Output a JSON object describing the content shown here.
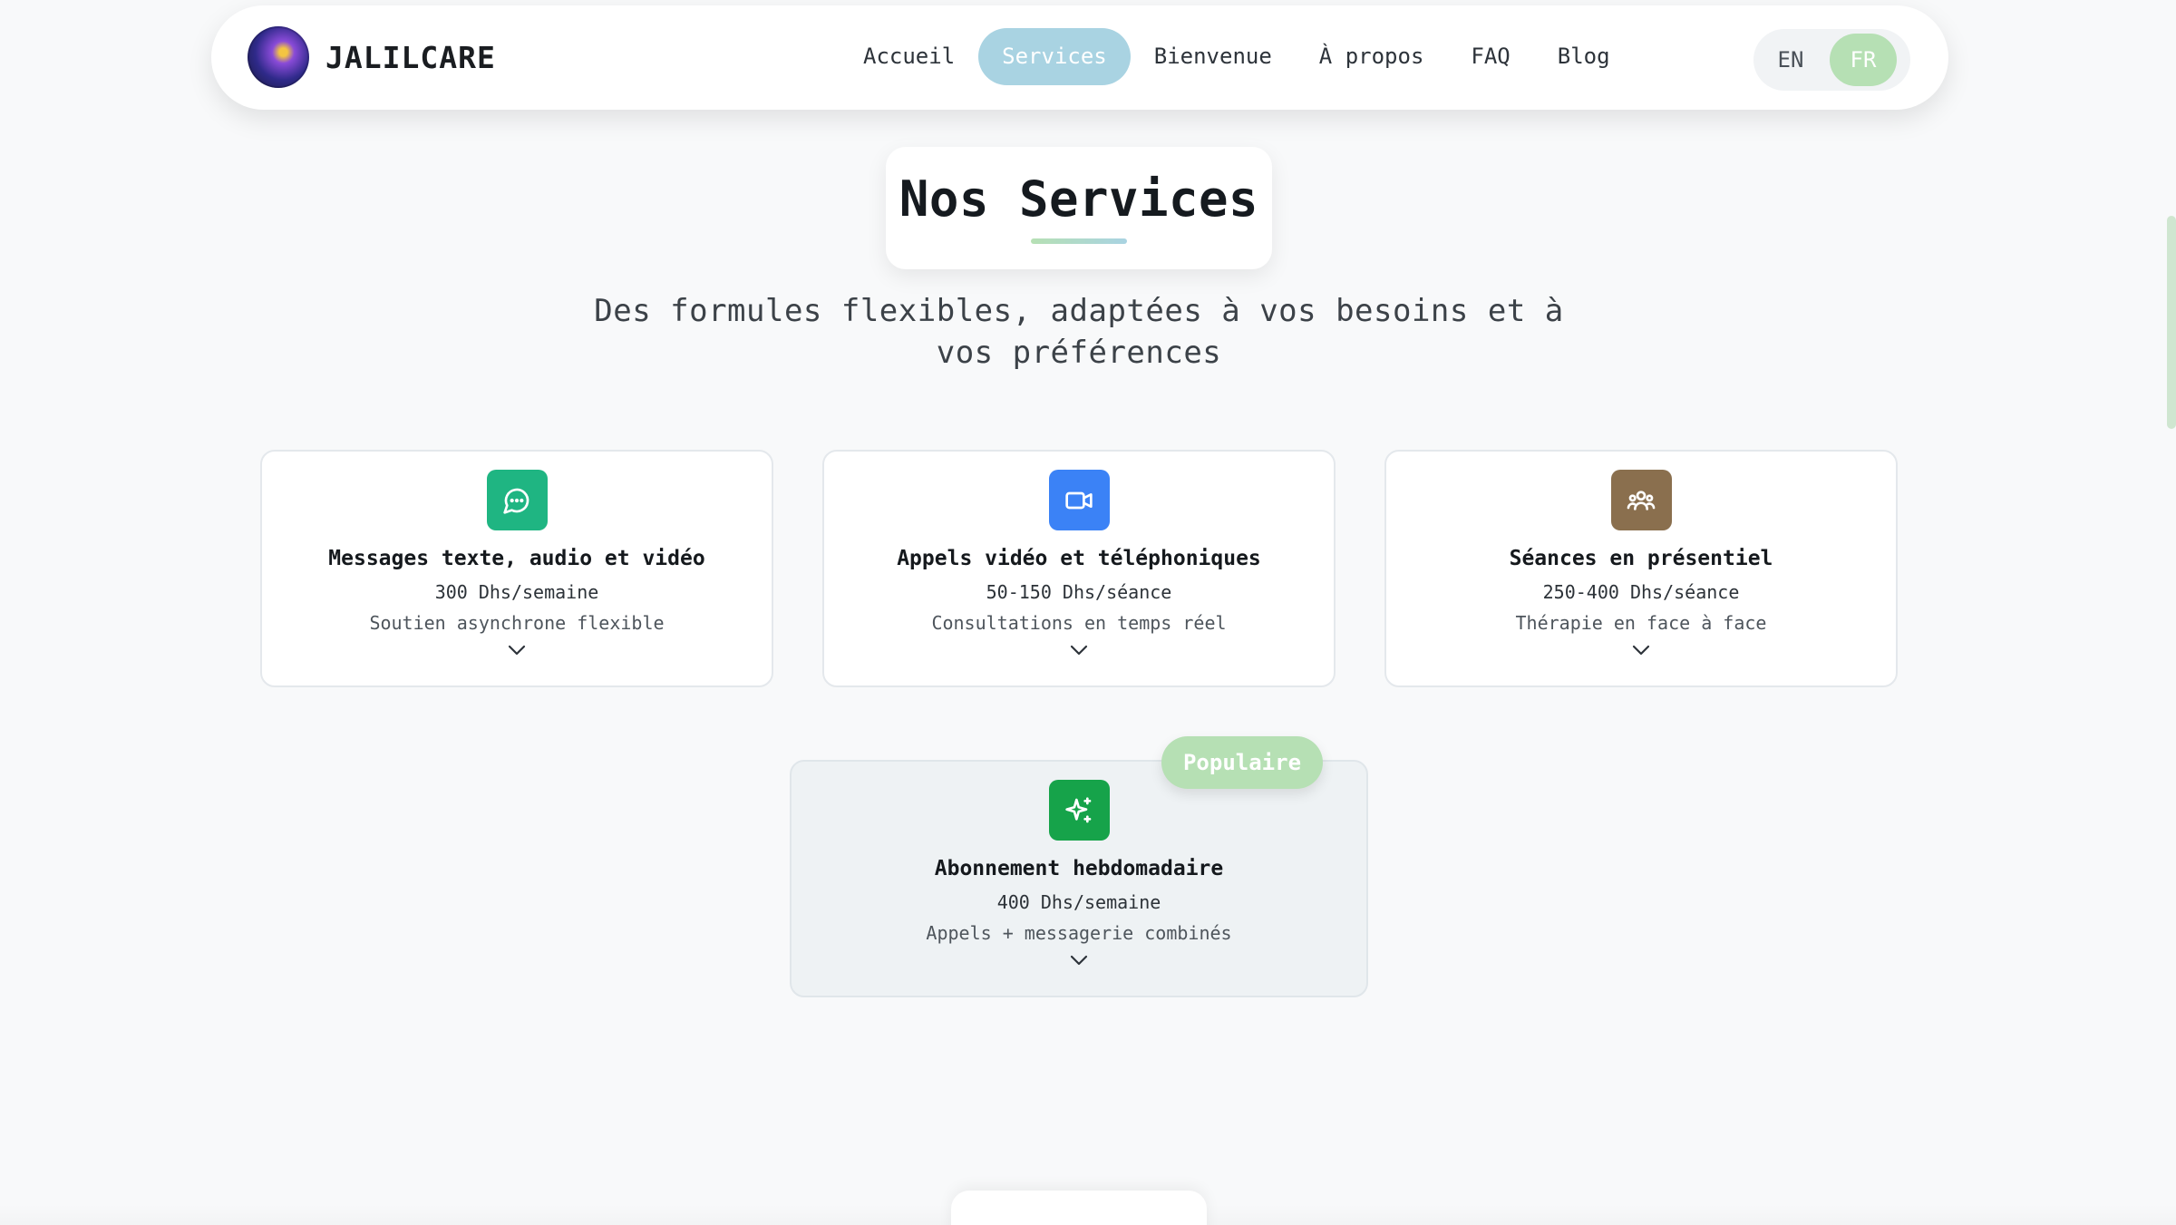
{
  "brand": {
    "name": "JALILCARE"
  },
  "nav": {
    "items": [
      {
        "label": "Accueil",
        "active": false
      },
      {
        "label": "Services",
        "active": true
      },
      {
        "label": "Bienvenue",
        "active": false
      },
      {
        "label": "À propos",
        "active": false
      },
      {
        "label": "FAQ",
        "active": false
      },
      {
        "label": "Blog",
        "active": false
      }
    ]
  },
  "language": {
    "options": [
      "EN",
      "FR"
    ],
    "selected": "FR"
  },
  "section": {
    "title": "Nos Services",
    "subtitle_line1": "Des formules flexibles, adaptées à vos besoins et à",
    "subtitle_line2": "vos préférences"
  },
  "services": [
    {
      "title": "Messages texte, audio et vidéo",
      "price": "300 Dhs/semaine",
      "description": "Soutien asynchrone flexible",
      "icon": "chat-bubble-icon",
      "color": "#1fb582"
    },
    {
      "title": "Appels vidéo et téléphoniques",
      "price": "50-150 Dhs/séance",
      "description": "Consultations en temps réel",
      "icon": "video-camera-icon",
      "color": "#3b82f6"
    },
    {
      "title": "Séances en présentiel",
      "price": "250-400 Dhs/séance",
      "description": "Thérapie en face à face",
      "icon": "users-group-icon",
      "color": "#8a6f4e"
    }
  ],
  "featured": {
    "badge": "Populaire",
    "title": "Abonnement hebdomadaire",
    "price": "400 Dhs/semaine",
    "description": "Appels + messagerie combinés",
    "icon": "sparkles-icon",
    "color": "#16a34a"
  },
  "colors": {
    "accent_blue": "#a9d3e2",
    "accent_green": "#b6e0b4",
    "background": "#f8f9fa"
  }
}
